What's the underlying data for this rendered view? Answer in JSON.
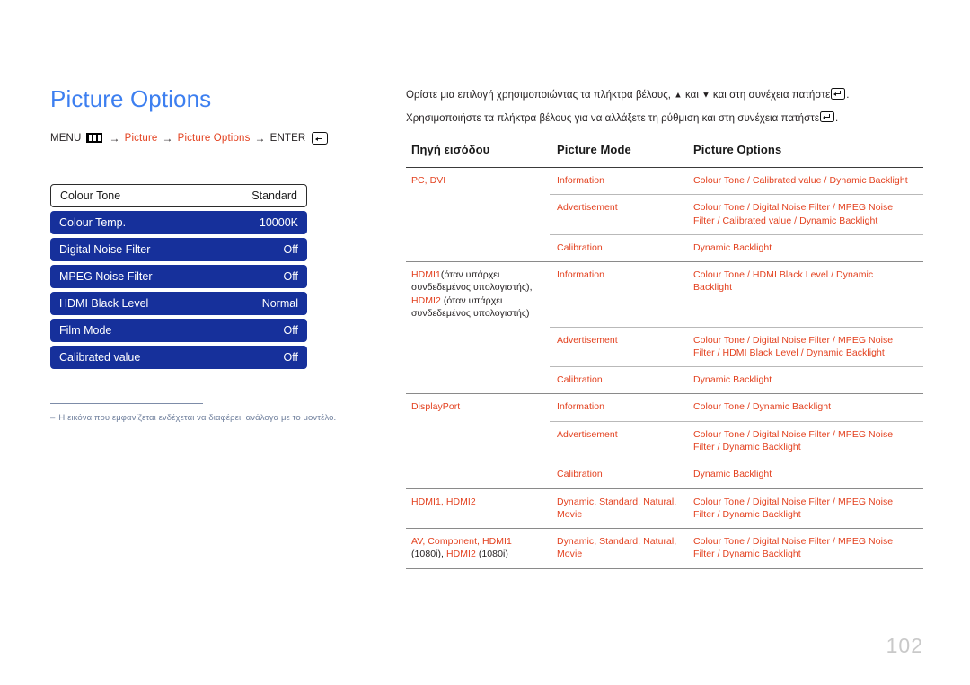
{
  "page": {
    "title": "Picture Options",
    "number": "102"
  },
  "breadcrumb": {
    "menu_label": "MENU",
    "menu_icon": "menu-bars-icon",
    "arrow": "→",
    "item1": "Picture",
    "item2": "Picture Options",
    "enter_label": "ENTER",
    "enter_icon": "enter-key-icon"
  },
  "osd": {
    "rows": [
      {
        "label": "Colour Tone",
        "value": "Standard",
        "state": "selected"
      },
      {
        "label": "Colour Temp.",
        "value": "10000K",
        "state": "normal"
      },
      {
        "label": "Digital Noise Filter",
        "value": "Off",
        "state": "normal"
      },
      {
        "label": "MPEG Noise Filter",
        "value": "Off",
        "state": "normal"
      },
      {
        "label": "HDMI Black Level",
        "value": "Normal",
        "state": "normal"
      },
      {
        "label": "Film Mode",
        "value": "Off",
        "state": "normal"
      },
      {
        "label": "Calibrated value",
        "value": "Off",
        "state": "normal"
      }
    ]
  },
  "footnote": {
    "dash": "–",
    "text": "Η εικόνα που εμφανίζεται ενδέχεται να διαφέρει, ανάλογα με το μοντέλο."
  },
  "intro": {
    "line1_a": "Ορίστε μια επιλογή χρησιμοποιώντας τα πλήκτρα βέλους,",
    "up_arrow": "▲",
    "and": "και",
    "down_arrow": "▼",
    "line1_b": "και στη συνέχεια πατήστε",
    "period": ".",
    "line2_a": "Χρησιμοποιήστε τα πλήκτρα βέλους για να αλλάξετε τη ρύθμιση και στη συνέχεια πατήστε"
  },
  "table": {
    "headers": {
      "source": "Πηγή εισόδου",
      "mode": "Picture Mode",
      "options": "Picture Options"
    },
    "rows": [
      {
        "source": "PC, DVI",
        "source_note": "",
        "mode": "Information",
        "options": "Colour Tone / Calibrated value / Dynamic Backlight",
        "group_start": true
      },
      {
        "source": "",
        "source_note": "",
        "mode": "Advertisement",
        "options": "Colour Tone / Digital Noise Filter / MPEG Noise Filter / Calibrated value / Dynamic Backlight",
        "group_start": false
      },
      {
        "source": "",
        "source_note": "",
        "mode": "Calibration",
        "options": "Dynamic Backlight",
        "group_start": false
      },
      {
        "source": "HDMI1",
        "source_note": "(όταν υπάρχει συνδεδεμένος υπολογιστής),",
        "source2": "HDMI2",
        "source_note2": " (όταν υπάρχει συνδεδεμένος υπολογιστής)",
        "mode": "Information",
        "options": "Colour Tone / HDMI Black Level / Dynamic Backlight",
        "group_start": true
      },
      {
        "source": "",
        "source_note": "",
        "mode": "Advertisement",
        "options": "Colour Tone / Digital Noise Filter / MPEG Noise Filter / HDMI Black Level / Dynamic Backlight",
        "group_start": false
      },
      {
        "source": "",
        "source_note": "",
        "mode": "Calibration",
        "options": "Dynamic Backlight",
        "group_start": false
      },
      {
        "source": "DisplayPort",
        "source_note": "",
        "mode": "Information",
        "options": "Colour Tone / Dynamic Backlight",
        "group_start": true
      },
      {
        "source": "",
        "source_note": "",
        "mode": "Advertisement",
        "options": "Colour Tone / Digital Noise Filter / MPEG Noise Filter / Dynamic Backlight",
        "group_start": false
      },
      {
        "source": "",
        "source_note": "",
        "mode": "Calibration",
        "options": "Dynamic Backlight",
        "group_start": false
      },
      {
        "source": "HDMI1, HDMI2",
        "source_note": "",
        "mode": "Dynamic, Standard, Natural, Movie",
        "options": "Colour Tone / Digital Noise Filter / MPEG Noise Filter / Dynamic Backlight",
        "group_start": true
      },
      {
        "source": "AV, Component, HDMI1",
        "source_note": " (1080i), ",
        "source2": "HDMI2",
        "source_note2": " (1080i)",
        "mode": "Dynamic, Standard, Natural, Movie",
        "options": "Colour Tone / Digital Noise Filter / MPEG Noise Filter / Dynamic Backlight",
        "group_start": true
      }
    ]
  },
  "colors": {
    "title_blue": "#3d7ff0",
    "osd_blue": "#16309b",
    "accent_orange": "#e3411f",
    "footnote_gray": "#6f7f9c",
    "page_num_gray": "#c9c9c9"
  }
}
